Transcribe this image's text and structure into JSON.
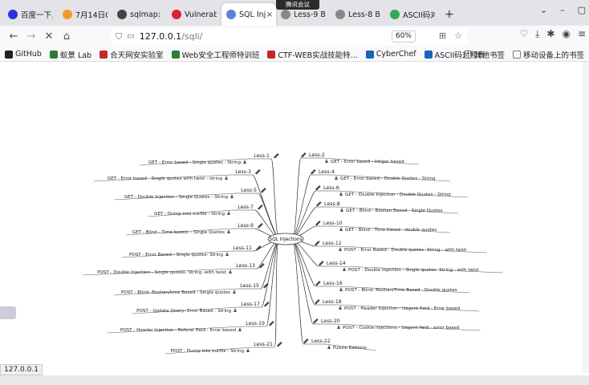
{
  "tabs": [
    {
      "label": "百度一下，你就",
      "color": "#2932e1",
      "active": false
    },
    {
      "label": "7月14日CTF-",
      "color": "#f29b26",
      "active": false
    },
    {
      "label": "sqlmap: a",
      "color": "#444444",
      "active": false
    },
    {
      "label": "Vulnerabi",
      "color": "#d23",
      "active": false
    },
    {
      "label": "SQL Inj",
      "color": "#5a80e0",
      "active": true
    },
    {
      "label": "Less-9 Blind",
      "color": "#888888",
      "active": false
    },
    {
      "label": "Less-8 Blind",
      "color": "#888888",
      "active": false
    },
    {
      "label": "ASCII码对",
      "color": "#33aa55",
      "active": false
    }
  ],
  "meeting_badge": "腾讯会议",
  "url": {
    "host": "127.0.0.1",
    "path": "/sqli/"
  },
  "zoom": "60%",
  "bookmarks": [
    {
      "label": "GitHub",
      "color": "#222"
    },
    {
      "label": "蚁景 Lab",
      "color": "#2e7d32"
    },
    {
      "label": "合天网安实验室",
      "color": "#c62828"
    },
    {
      "label": "Web安全工程师特训班",
      "color": "#2e7d32"
    },
    {
      "label": "CTF-WEB实战技能特...",
      "color": "#c62828"
    },
    {
      "label": "CyberChef",
      "color": "#1565c0"
    },
    {
      "label": "ASCII码对照表",
      "color": "#1565c0"
    }
  ],
  "bookmarks_right": [
    "其他书签",
    "移动设备上的书签"
  ],
  "status": "127.0.0.1",
  "mindmap": {
    "center": "SQL Injections",
    "left": [
      {
        "less": "Less-1",
        "desc": "GET - Error based - Single quotes - String"
      },
      {
        "less": "Less-3",
        "desc": "GET - Error based - Single quotes with twist - string"
      },
      {
        "less": "Less-5",
        "desc": "GET - Double Injection - Single Quotes - String"
      },
      {
        "less": "Less-7",
        "desc": "GET - Dump into outfile - String"
      },
      {
        "less": "Less-9",
        "desc": "GET - Blind - Time based. - Single Quotes"
      },
      {
        "less": "Less-11",
        "desc": "POST - Error Based - Single quotes- String"
      },
      {
        "less": "Less-13",
        "desc": "POST - Double Injection - Single quotes- String -with twist"
      },
      {
        "less": "Less-15",
        "desc": "POST - Blind- Boolian/time Based - Single quotes"
      },
      {
        "less": "Less-17",
        "desc": "POST - Update Query- Error Based - String"
      },
      {
        "less": "Less-19",
        "desc": "POST - Header Injection - Referer field - Error based"
      },
      {
        "less": "Less-21",
        "desc": "POST - Dump into outfile - String"
      }
    ],
    "right": [
      {
        "less": "Less-2",
        "desc": "GET - Error based - Intiger based"
      },
      {
        "less": "Less-4",
        "desc": "GET - Error based - Double Quotes - String"
      },
      {
        "less": "Less-6",
        "desc": "GET - Double Injection - Double Quotes - String"
      },
      {
        "less": "Less-8",
        "desc": "GET - Blind - Boolian Based - Single Quotes"
      },
      {
        "less": "Less-10",
        "desc": "GET - Blind - Time based - double quotes"
      },
      {
        "less": "Less-12",
        "desc": "POST - Error Based - Double quotes- String - with twist"
      },
      {
        "less": "Less-14",
        "desc": "POST - Double Injection - Single quotes- String - with twist"
      },
      {
        "less": "Less-16",
        "desc": "POST - Blind- Boolian/Time Based - Double quotes"
      },
      {
        "less": "Less-18",
        "desc": "POST - Header Injection - Uagent field - Error based"
      },
      {
        "less": "Less-20",
        "desc": "POST - Cookie injections - Uagent field - error based"
      },
      {
        "less": "Less-22",
        "desc": "Future Editions"
      }
    ]
  }
}
